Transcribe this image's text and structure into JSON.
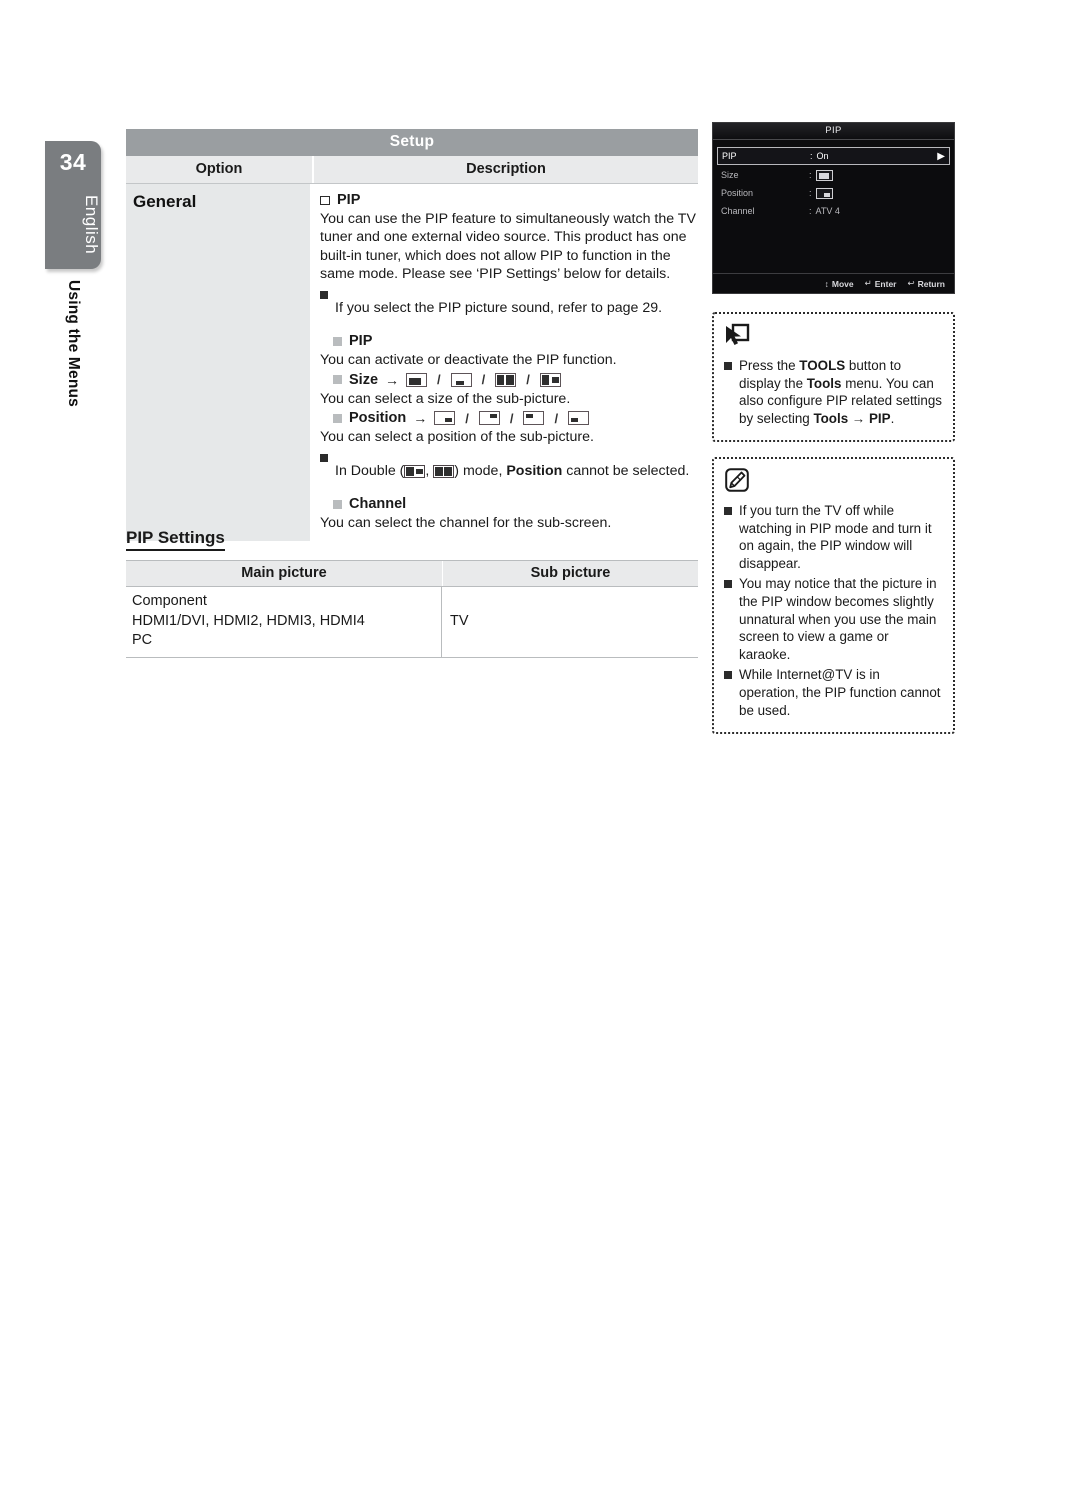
{
  "page": {
    "number": "34",
    "language": "English",
    "chapter": "Using the Menus"
  },
  "setup_table": {
    "title": "Setup",
    "headers": {
      "option": "Option",
      "description": "Description"
    },
    "option_name": "General",
    "items": {
      "pip_heading": "PIP",
      "pip_body": "You can use the PIP feature to simultaneously watch the TV tuner and one external video source. This product has one built-in tuner, which does not allow PIP to function in the same mode. Please see ‘PIP Settings’ below for details.",
      "pip_note": "If you select the PIP picture sound, refer to page 29.",
      "sub_pip_heading": "PIP",
      "sub_pip_body": "You can activate or deactivate the PIP function.",
      "size_heading": "Size",
      "size_body": "You can select a size of the sub-picture.",
      "position_heading": "Position",
      "position_body": "You can select a position of the sub-picture.",
      "double_note_pre": "In Double (",
      "double_note_mid": ", ",
      "double_note_post": ") mode, ",
      "double_note_bold": "Position",
      "double_note_end": " cannot be selected.",
      "channel_heading": "Channel",
      "channel_body": "You can select the channel for the sub-screen.",
      "arrow": "→",
      "slash": "/"
    }
  },
  "pip_settings": {
    "title": "PIP Settings",
    "headers": [
      "Main picture",
      "Sub picture"
    ],
    "rows": [
      {
        "main": [
          "Component",
          "HDMI1/DVI, HDMI2, HDMI3, HDMI4",
          "PC"
        ],
        "sub": "TV"
      }
    ]
  },
  "osd": {
    "title": "PIP",
    "rows": [
      {
        "label": "PIP",
        "colon": ":",
        "value": "On",
        "type": "text",
        "selected": true
      },
      {
        "label": "Size",
        "colon": ":",
        "value": "",
        "type": "size-icon",
        "selected": false
      },
      {
        "label": "Position",
        "colon": ":",
        "value": "",
        "type": "position-icon",
        "selected": false
      },
      {
        "label": "Channel",
        "colon": ":",
        "value": "ATV 4",
        "type": "text",
        "selected": false
      }
    ],
    "footer": [
      {
        "icon": "↕",
        "label": "Move"
      },
      {
        "icon": "↵",
        "label": "Enter"
      },
      {
        "icon": "↩",
        "label": "Return"
      }
    ]
  },
  "tools_note": {
    "icon": "tools-cursor-icon",
    "text_1": "Press the ",
    "bold_1": "TOOLS",
    "text_2": " button to display the ",
    "bold_2": "Tools",
    "text_3": " menu. You can also configure PIP related settings by selecting ",
    "bold_3": "Tools",
    "arrow": " → ",
    "bold_4": "PIP",
    "text_4": "."
  },
  "notes": {
    "icon": "note-pencil-icon",
    "items": [
      "If you turn the TV off while watching in PIP mode and turn it on again, the PIP window will disappear.",
      "You may notice that the picture in the PIP window becomes slightly unnatural when you use the main screen to view a game or karaoke.",
      "While Internet@TV is in operation, the PIP function cannot be used."
    ]
  },
  "colors": {
    "table_title_bg": "#9a9ea1",
    "table_head_bg": "#e9eaeb",
    "option_cell_bg": "#e6e8e9",
    "tab_bg": "#7a7d80",
    "osd_bg": "#0c0c0e"
  }
}
